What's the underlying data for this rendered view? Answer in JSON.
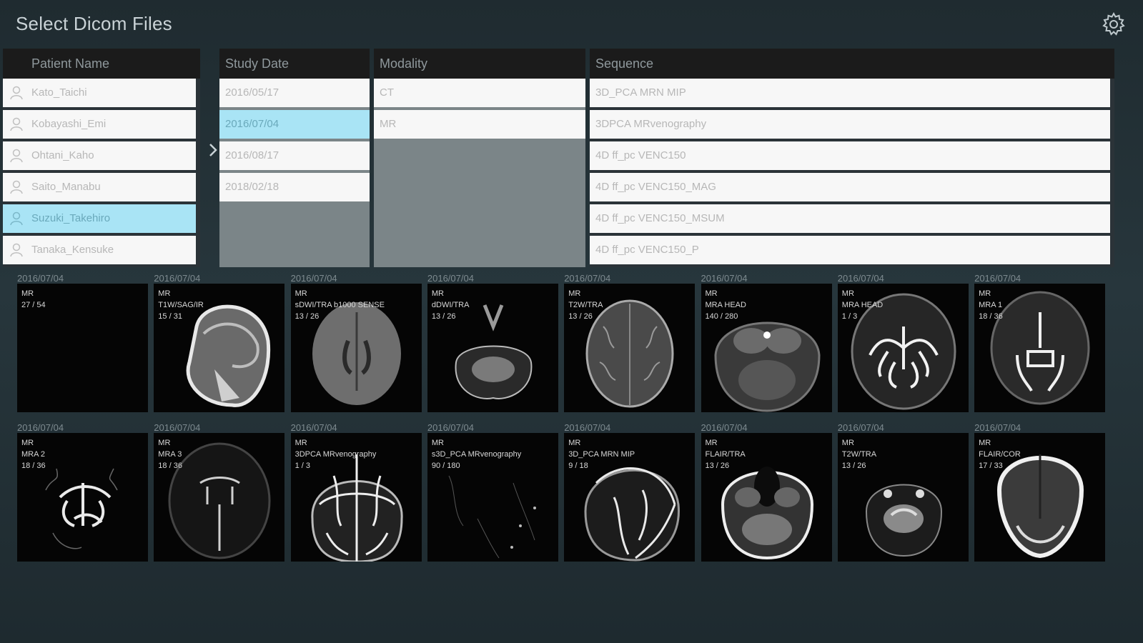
{
  "header": {
    "title": "Select Dicom Files",
    "settings_icon": "gear-icon"
  },
  "columns": {
    "patient": "Patient Name",
    "study_date": "Study Date",
    "modality": "Modality",
    "sequence": "Sequence"
  },
  "patients": [
    {
      "name": "Kato_Taichi",
      "selected": false
    },
    {
      "name": "Kobayashi_Emi",
      "selected": false
    },
    {
      "name": "Ohtani_Kaho",
      "selected": false
    },
    {
      "name": "Saito_Manabu",
      "selected": false
    },
    {
      "name": "Suzuki_Takehiro",
      "selected": true
    },
    {
      "name": "Tanaka_Kensuke",
      "selected": false
    }
  ],
  "study_dates": [
    {
      "date": "2016/05/17",
      "selected": false
    },
    {
      "date": "2016/07/04",
      "selected": true
    },
    {
      "date": "2016/08/17",
      "selected": false
    },
    {
      "date": "2018/02/18",
      "selected": false
    }
  ],
  "modalities": [
    "CT",
    "MR"
  ],
  "sequences": [
    "3D_PCA MRN MIP",
    "3DPCA  MRvenography",
    "4D ff_pc VENC150",
    "4D ff_pc VENC150_MAG",
    "4D ff_pc VENC150_MSUM",
    "4D ff_pc VENC150_P"
  ],
  "thumbnails": [
    {
      "date": "2016/07/04",
      "modality": "MR",
      "series": "",
      "count": "27 / 54",
      "kind": "blank"
    },
    {
      "date": "2016/07/04",
      "modality": "MR",
      "series": "T1W/SAG/IR",
      "count": "15 / 31",
      "kind": "sag"
    },
    {
      "date": "2016/07/04",
      "modality": "MR",
      "series": "sDWI/TRA b1000 SENSE",
      "count": "13 / 26",
      "kind": "axial-gray"
    },
    {
      "date": "2016/07/04",
      "modality": "MR",
      "series": "dDWI/TRA",
      "count": "13 / 26",
      "kind": "base"
    },
    {
      "date": "2016/07/04",
      "modality": "MR",
      "series": "T2W/TRA",
      "count": "13 / 26",
      "kind": "axial-sulci"
    },
    {
      "date": "2016/07/04",
      "modality": "MR",
      "series": "MRA HEAD",
      "count": "140 / 280",
      "kind": "mra-src"
    },
    {
      "date": "2016/07/04",
      "modality": "MR",
      "series": "MRA HEAD",
      "count": "1 / 3",
      "kind": "mra-mip"
    },
    {
      "date": "2016/07/04",
      "modality": "MR",
      "series": "MRA 1",
      "count": "18 / 36",
      "kind": "mra-cor"
    },
    {
      "date": "2016/07/04",
      "modality": "MR",
      "series": "MRA 2",
      "count": "18 / 36",
      "kind": "mra-vessels"
    },
    {
      "date": "2016/07/04",
      "modality": "MR",
      "series": "MRA 3",
      "count": "18 / 36",
      "kind": "mra-faint"
    },
    {
      "date": "2016/07/04",
      "modality": "MR",
      "series": "3DPCA  MRvenography",
      "count": "1 / 3",
      "kind": "veno"
    },
    {
      "date": "2016/07/04",
      "modality": "MR",
      "series": "s3D_PCA MRvenography",
      "count": "90 / 180",
      "kind": "dark"
    },
    {
      "date": "2016/07/04",
      "modality": "MR",
      "series": "3D_PCA MRN MIP",
      "count": "9 / 18",
      "kind": "veno-sag"
    },
    {
      "date": "2016/07/04",
      "modality": "MR",
      "series": "FLAIR/TRA",
      "count": "13 / 26",
      "kind": "flair-base"
    },
    {
      "date": "2016/07/04",
      "modality": "MR",
      "series": "T2W/TRA",
      "count": "13 / 26",
      "kind": "t2-base"
    },
    {
      "date": "2016/07/04",
      "modality": "MR",
      "series": "FLAIR/COR",
      "count": "17 / 33",
      "kind": "flair-cor"
    }
  ]
}
